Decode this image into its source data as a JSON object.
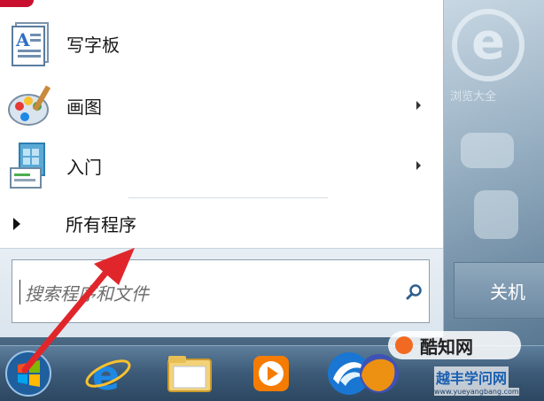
{
  "start_menu": {
    "items": [
      {
        "label": "写字板",
        "icon": "wordpad-icon",
        "has_submenu": false
      },
      {
        "label": "画图",
        "icon": "paint-icon",
        "has_submenu": true
      },
      {
        "label": "入门",
        "icon": "getting-started-icon",
        "has_submenu": true
      }
    ],
    "all_programs_label": "所有程序",
    "search": {
      "placeholder": "搜索程序和文件",
      "value": ""
    },
    "shutdown_label": "关机"
  },
  "desktop": {
    "icon_label": "浏览大全"
  },
  "taskbar": {
    "icons": [
      "start-orb-icon",
      "internet-explorer-icon",
      "windows-explorer-icon",
      "media-player-icon",
      "browser-icon",
      "firefox-icon"
    ]
  },
  "watermarks": {
    "brand_1": "酷知网",
    "brand_2": "越丰学问网",
    "brand_2_url": "www.yueyangbang.com"
  },
  "colors": {
    "annotation_arrow": "#e0262b",
    "taskbar": "#3c5a77",
    "start_red": "#c8102e"
  }
}
